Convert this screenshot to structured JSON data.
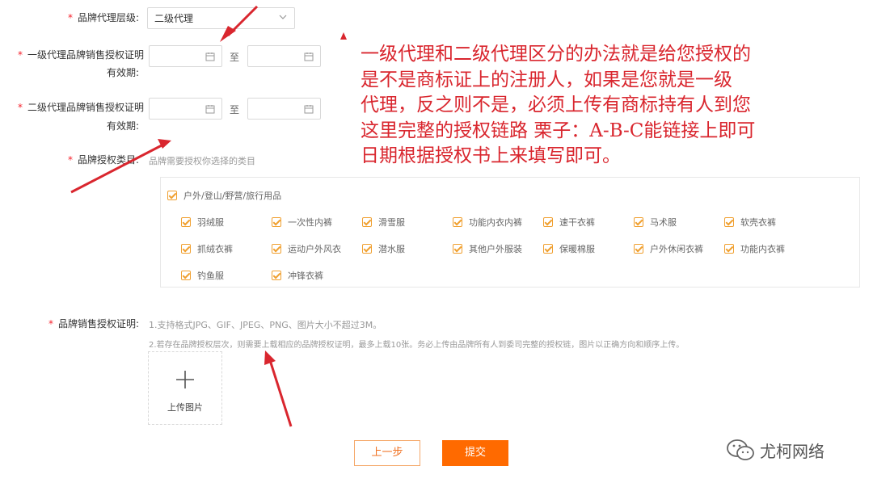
{
  "form": {
    "agent_level": {
      "label": "品牌代理层级:",
      "value": "二级代理"
    },
    "first_cert": {
      "label_line1": "一级代理品牌销售授权证明",
      "label_line2": "有效期:",
      "to": "至"
    },
    "second_cert": {
      "label_line1": "二级代理品牌销售授权证明",
      "label_line2": "有效期:",
      "to": "至"
    },
    "category": {
      "label": "品牌授权类目:",
      "hint": "品牌需要授权你选择的类目"
    },
    "category_group": {
      "parent": "户外/登山/野营/旅行用品",
      "items": [
        "羽绒服",
        "一次性内裤",
        "滑雪服",
        "功能内衣内裤",
        "速干衣裤",
        "马术服",
        "软壳衣裤",
        "抓绒衣裤",
        "运动户外风衣",
        "潜水服",
        "其他户外服装",
        "保暖棉服",
        "户外休闲衣裤",
        "功能内衣裤",
        "钓鱼服",
        "冲锋衣裤"
      ]
    },
    "sales_cert": {
      "label": "品牌销售授权证明:",
      "hint1": "1.支持格式JPG、GIF、JPEG、PNG、图片大小不超过3M。",
      "hint2": "2.若存在品牌授权层次，则需要上载相应的品牌授权证明，最多上载10张。务必上传由品牌所有人到委司完整的授权链，图片以正确方向和顺序上传。",
      "upload_label": "上传图片"
    },
    "buttons": {
      "prev": "上一步",
      "submit": "提交"
    }
  },
  "annotation": {
    "text": "一级代理和二级代理区分的办法就是给您授权的\n是不是商标证上的注册人，如果是您就是一级\n代理，反之则不是，必须上传有商标持有人到您\n这里完整的授权链路 栗子：A-B-C能链接上即可\n日期根据授权书上来填写即可。"
  },
  "watermark": {
    "text": "尤柯网络",
    "icon": "wechat-icon"
  },
  "colors": {
    "accent": "#ff6a00",
    "annotation": "#d9262e",
    "checkbox": "#f0a030",
    "required": "#f5222d"
  }
}
